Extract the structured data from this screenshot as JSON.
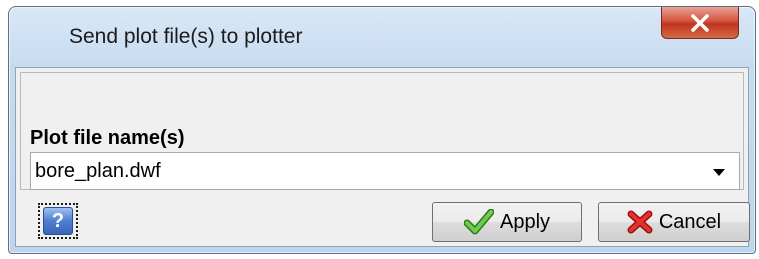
{
  "window": {
    "title": "Send plot file(s) to plotter"
  },
  "form": {
    "plot_files_label": "Plot file name(s)",
    "plot_files_value": "bore_plan.dwf"
  },
  "buttons": {
    "help_label": "?",
    "apply_label": "Apply",
    "cancel_label": "Cancel"
  },
  "icons": {
    "close": "close-icon",
    "help": "help-icon",
    "apply": "checkmark-icon",
    "cancel": "red-x-icon",
    "dropdown": "chevron-down-icon"
  },
  "colors": {
    "close_button": "#c0341d",
    "apply_check": "#3a9a2a",
    "cancel_x": "#d22020",
    "help_icon": "#4f7fd0"
  }
}
